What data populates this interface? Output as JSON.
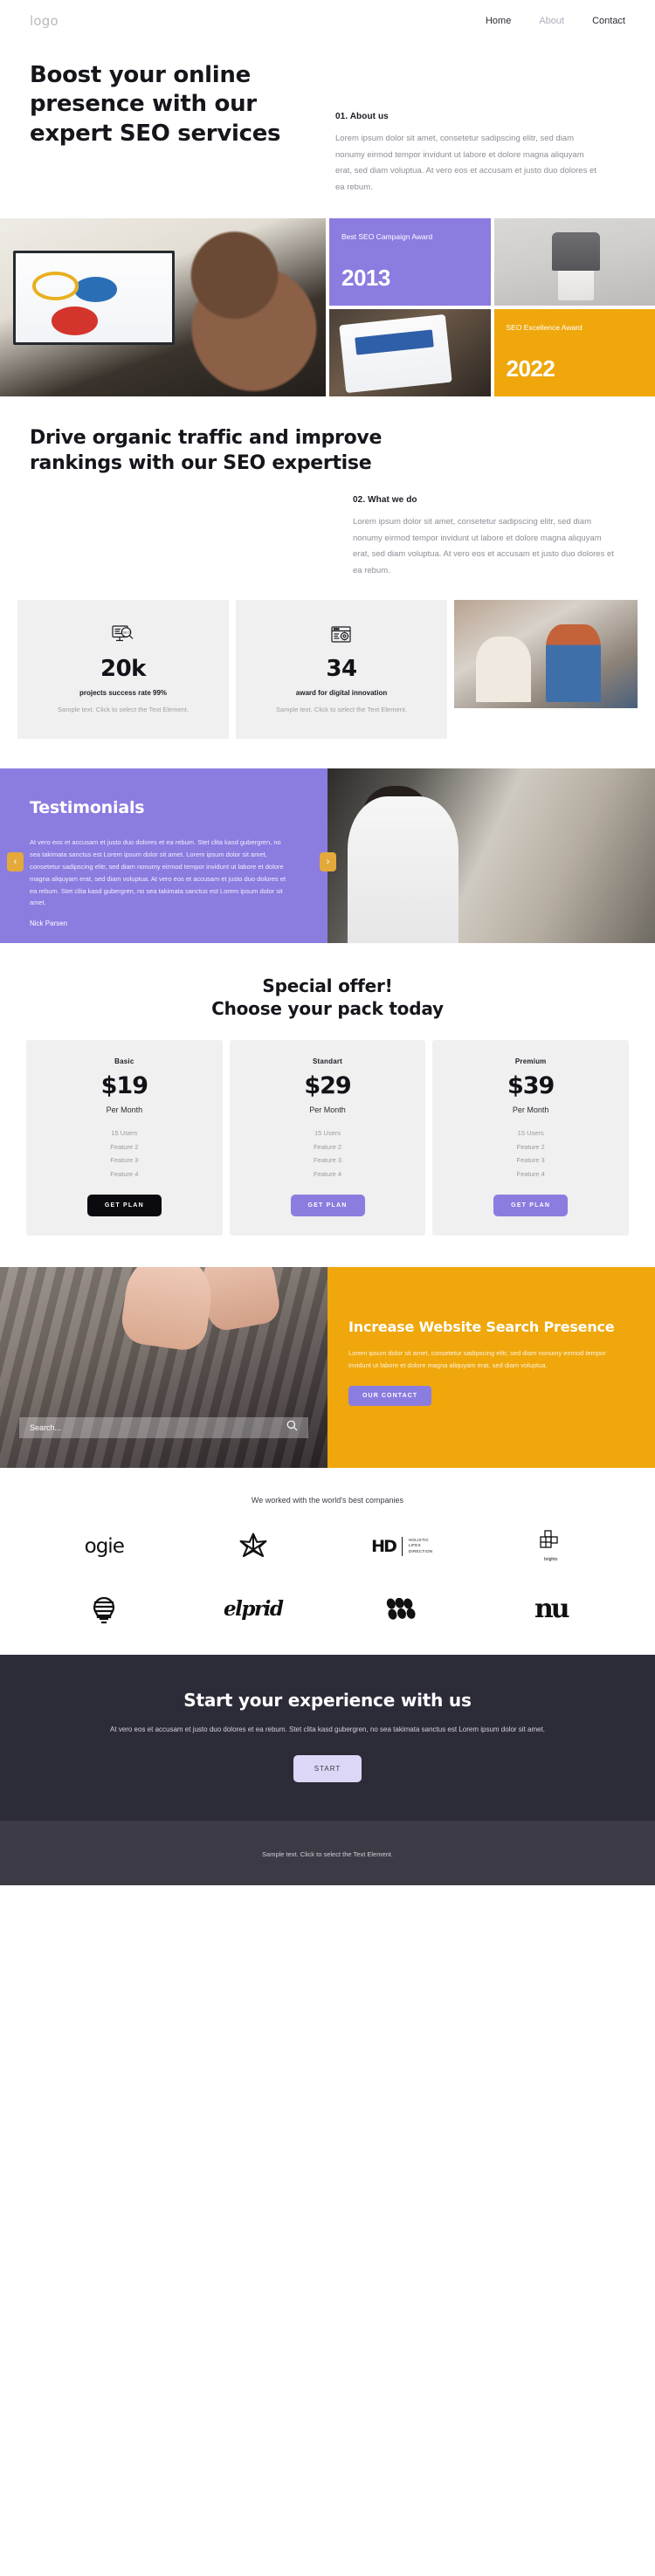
{
  "header": {
    "logo": "logo",
    "nav": [
      {
        "label": "Home",
        "active": true
      },
      {
        "label": "About",
        "active": false
      },
      {
        "label": "Contact",
        "active": false
      }
    ]
  },
  "hero": {
    "title": "Boost your online presence with our expert SEO services",
    "kicker": "01. About us",
    "copy": "Lorem ipsum dolor sit amet, consetetur sadipscing elitr, sed diam nonumy eirmod tempor invidunt ut labore et dolore magna aliquyam erat, sed diam voluptua. At vero eos et accusam et justo duo dolores et ea rebum."
  },
  "awards": [
    {
      "label": "Best SEO Campaign Award",
      "year": "2013",
      "color": "#8b7ce0"
    },
    {
      "label": "SEO Excellence Award",
      "year": "2022",
      "color": "#efa70c"
    }
  ],
  "whatwedo": {
    "title": "Drive organic traffic and improve rankings with our SEO expertise",
    "kicker": "02. What we do",
    "copy": "Lorem ipsum dolor sit amet, consetetur sadipscing elitr, sed diam nonumy eirmod tempor invidunt ut labore et dolore magna aliquyam erat, sed diam voluptua. At vero eos et accusam et justo duo dolores et ea rebum.",
    "stats": [
      {
        "icon": "seo-search-monitor-icon",
        "number": "20k",
        "label": "projects success rate 99%",
        "desc": "Sample text. Click to select the Text Element."
      },
      {
        "icon": "browser-gear-icon",
        "number": "34",
        "label": "award for digital innovation",
        "desc": "Sample text. Click to select the Text Element."
      }
    ]
  },
  "testimonials": {
    "heading": "Testimonials",
    "quote": "At vero eos et accusam et justo duo dolores et ea rebum. Stet clita kasd gubergren, no sea takimata sanctus est Lorem ipsum dolor sit amet. Lorem ipsum dolor sit amet, consetetur sadipscing elitr, sed diam nonumy eirmod tempor invidunt ut labore et dolore magna aliquyam erat, sed diam voluptua. At vero eos et accusam et justo duo dolores et ea rebum. Stet clita kasd gubergren, no sea takimata sanctus est Lorem ipsum dolor sit amet.",
    "author": "Nick Parsen",
    "prev_icon": "chevron-left-icon",
    "next_icon": "chevron-right-icon",
    "bg_color": "#8b7ce0",
    "arrow_color": "#e3a93a"
  },
  "pricing": {
    "title_line1": "Special offer!",
    "title_line2": "Choose your pack today",
    "plans": [
      {
        "name": "Basic",
        "price": "$19",
        "period": "Per Month",
        "features": [
          "15 Users",
          "Feature 2",
          "Feature 3",
          "Feature 4"
        ],
        "cta": "GET PLAN",
        "cta_style": "dark"
      },
      {
        "name": "Standart",
        "price": "$29",
        "period": "Per Month",
        "features": [
          "15 Users",
          "Feature 2",
          "Feature 3",
          "Feature 4"
        ],
        "cta": "GET PLAN",
        "cta_style": "purple"
      },
      {
        "name": "Premium",
        "price": "$39",
        "period": "Per Month",
        "features": [
          "15 Users",
          "Feature 2",
          "Feature 3",
          "Feature 4"
        ],
        "cta": "GET PLAN",
        "cta_style": "purple"
      }
    ]
  },
  "presence": {
    "search_placeholder": "Search...",
    "search_icon": "magnifier-icon",
    "title": "Increase Website Search Presence",
    "copy": "Lorem ipsum dolor sit amet, consetetur sadipscing elitr, sed diam nonumy eirmod tempor invidunt ut labore et dolore magna aliquyam erat, sed diam voluptua.",
    "cta": "OUR CONTACT",
    "bg_color": "#efa70c"
  },
  "partners": {
    "title": "We worked with the world's best companies",
    "logos": [
      {
        "name": "ogie-logo",
        "text": "ogie"
      },
      {
        "name": "flower-star-logo",
        "text": ""
      },
      {
        "name": "hd-holistic-lifes-direction-logo",
        "text": "HD"
      },
      {
        "name": "brighto-logo",
        "text": "brighto"
      },
      {
        "name": "striped-bulb-logo",
        "text": ""
      },
      {
        "name": "elprid-script-logo",
        "text": "elprid"
      },
      {
        "name": "dots-cluster-logo",
        "text": ""
      },
      {
        "name": "nu-serif-logo",
        "text": "nu"
      }
    ],
    "hd_sub": [
      "HOLISTIC",
      "LIFES",
      "DIRECTION"
    ]
  },
  "cta": {
    "title": "Start your experience with us",
    "copy": "At vero eos et accusam et justo duo dolores et ea rebum. Stet clita kasd gubergren, no sea takimata sanctus est Lorem ipsum dolor sit amet.",
    "button": "START",
    "bg_color": "#2c2b38"
  },
  "footer": {
    "text": "Sample text. Click to select the Text Element.",
    "bg_color": "#3b3a45"
  }
}
